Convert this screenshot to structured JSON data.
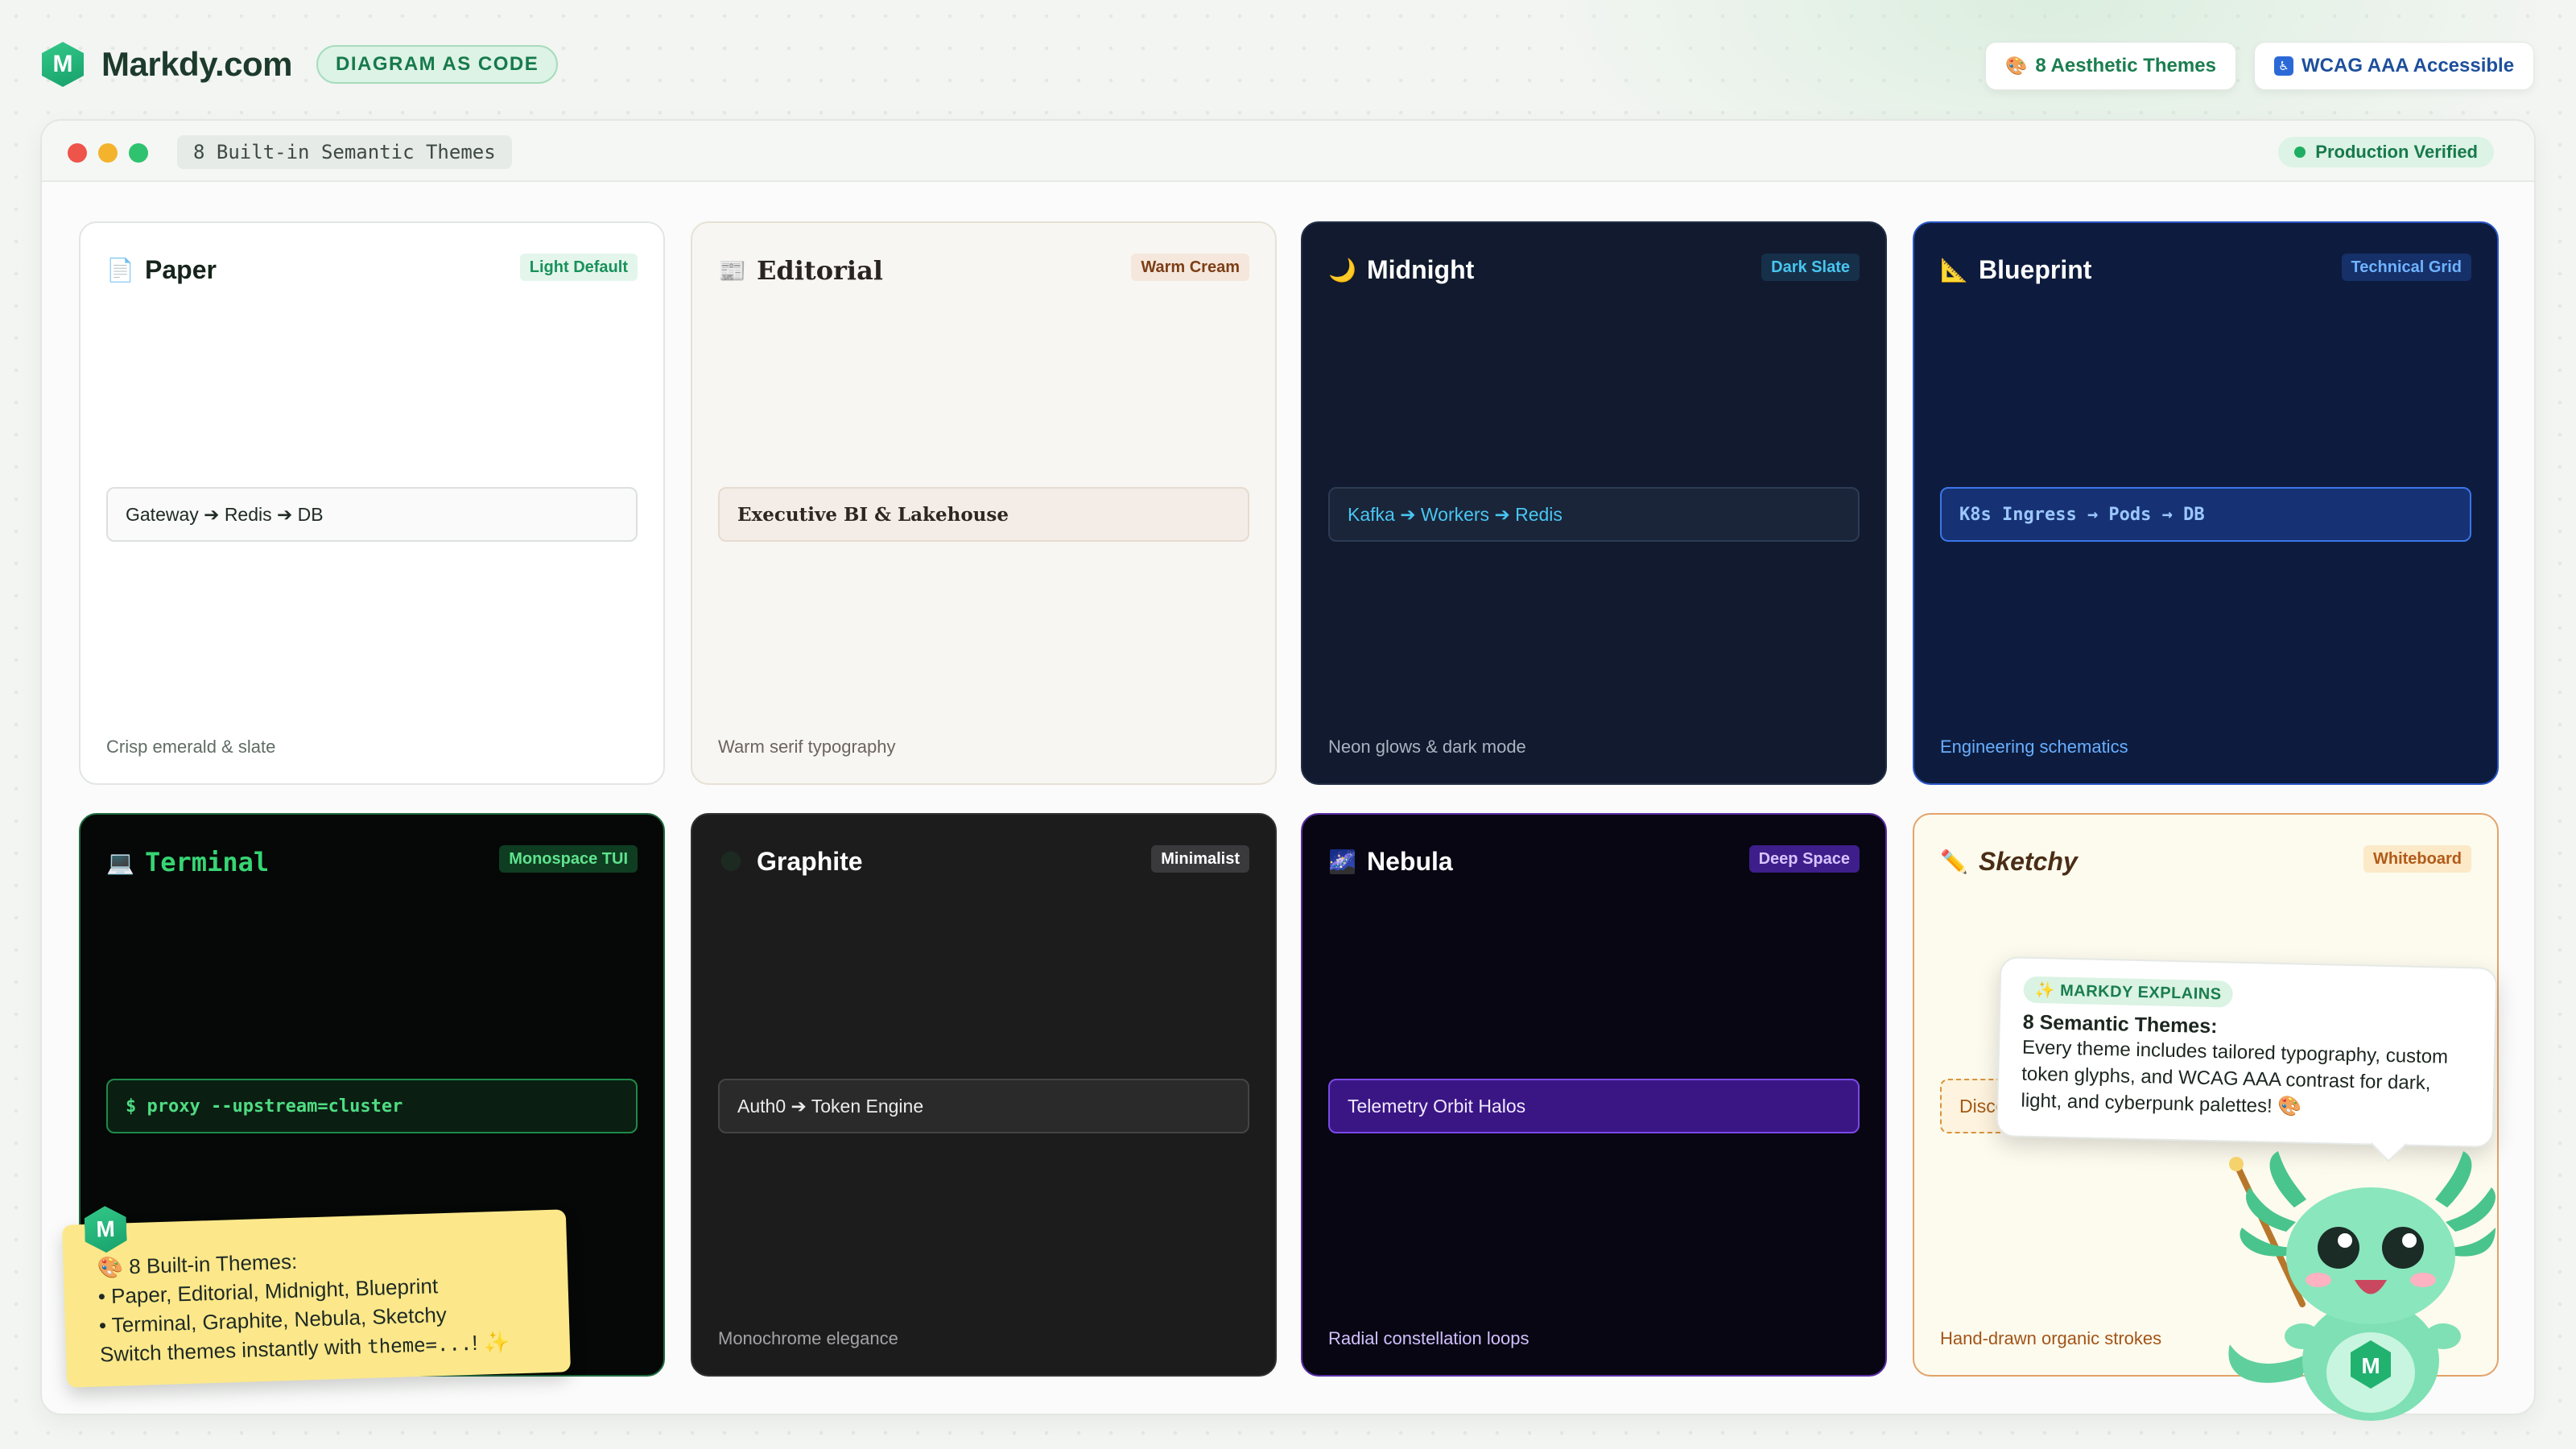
{
  "header": {
    "brand_name": "Markdy.com",
    "brand_tag": "DIAGRAM AS CODE",
    "pills": [
      {
        "icon": "palette-icon",
        "label": "8 Aesthetic Themes"
      },
      {
        "icon": "accessibility-icon",
        "label": "WCAG AAA Accessible"
      }
    ]
  },
  "window": {
    "title": "8 Built-in Semantic Themes",
    "status": "Production Verified"
  },
  "themes": [
    {
      "emoji": "📄",
      "name": "Paper",
      "badge": "Light Default",
      "flow": "Gateway ➔ Redis ➔ DB",
      "desc": "Crisp emerald & slate"
    },
    {
      "emoji": "📰",
      "name": "Editorial",
      "badge": "Warm Cream",
      "flow": "Executive BI & Lakehouse",
      "desc": "Warm serif typography"
    },
    {
      "emoji": "🌙",
      "name": "Midnight",
      "badge": "Dark Slate",
      "flow": "Kafka ➔ Workers ➔ Redis",
      "desc": "Neon glows & dark mode"
    },
    {
      "emoji": "📐",
      "name": "Blueprint",
      "badge": "Technical Grid",
      "flow": "K8s Ingress → Pods → DB",
      "desc": "Engineering schematics"
    },
    {
      "emoji": "💻",
      "name": "Terminal",
      "badge": "Monospace TUI",
      "flow": "$ proxy --upstream=cluster",
      "desc": ""
    },
    {
      "emoji": "🌑",
      "name": "Graphite",
      "badge": "Minimalist",
      "flow": "Auth0 ➔ Token Engine",
      "desc": "Monochrome elegance"
    },
    {
      "emoji": "🌌",
      "name": "Nebula",
      "badge": "Deep Space",
      "flow": "Telemetry Orbit Halos",
      "desc": "Radial constellation loops"
    },
    {
      "emoji": "✏️",
      "name": "Sketchy",
      "badge": "Whiteboard",
      "flow": "Disco",
      "desc": "Hand-drawn organic strokes"
    }
  ],
  "sticky": {
    "title": "🎨 8 Built-in Themes:",
    "line1": "• Paper, Editorial, Midnight, Blueprint",
    "line2": "• Terminal, Graphite, Nebula, Sketchy",
    "line3_prefix": "Switch themes instantly with ",
    "line3_code": "theme=...",
    "line3_suffix": "! ✨"
  },
  "bubble": {
    "tag": "✨ MARKDY EXPLAINS",
    "title": "8 Semantic Themes:",
    "body": "Every theme includes tailored typography, custom token glyphs, and WCAG AAA contrast for dark, light, and cyberpunk palettes! 🎨"
  }
}
